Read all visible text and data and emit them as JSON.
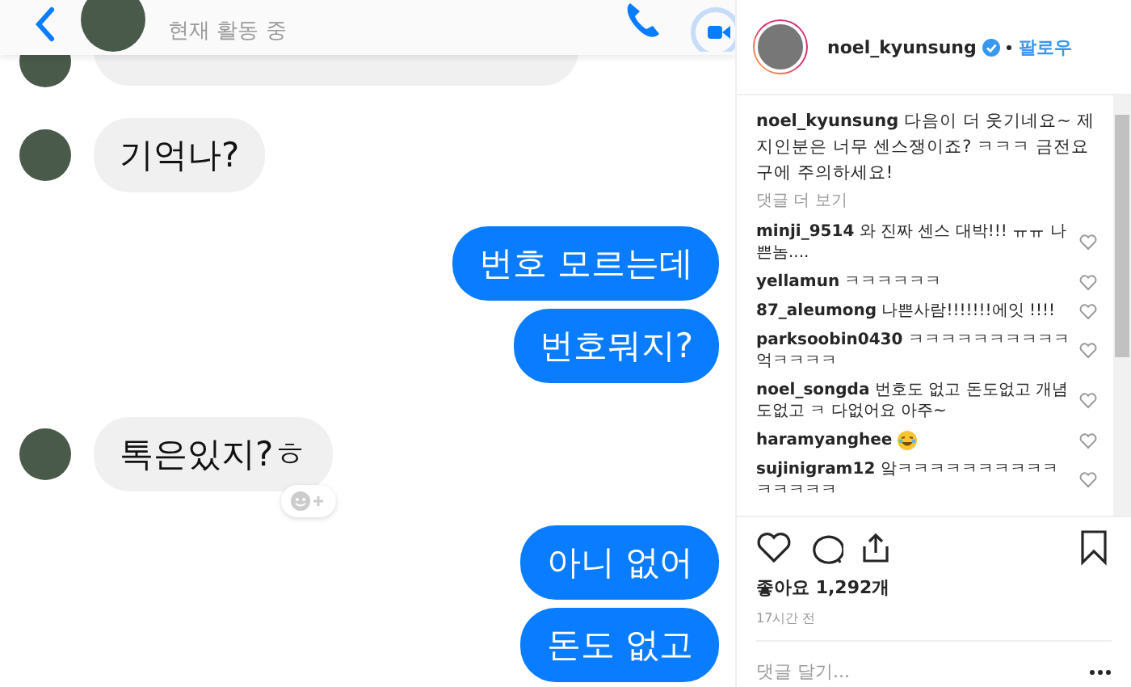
{
  "chat": {
    "status": "현재 활동 중",
    "messages": [
      {
        "kind": "partial",
        "avatar": true,
        "reaction_button": false
      },
      {
        "kind": "incoming",
        "text": "기억나?",
        "avatar": true,
        "reaction_button": false
      },
      {
        "kind": "outgoing",
        "text": "번호 모르는데",
        "avatar": false,
        "reaction_button": false
      },
      {
        "kind": "outgoing",
        "text": "번호뭐지?",
        "avatar": false,
        "reaction_button": false
      },
      {
        "kind": "incoming",
        "text": "톡은있지?ㅎ",
        "avatar": true,
        "reaction_button": true
      },
      {
        "kind": "outgoing",
        "text": "아니 없어",
        "avatar": false,
        "reaction_button": false
      },
      {
        "kind": "outgoing",
        "text": "돈도 없고",
        "avatar": false,
        "reaction_button": false
      }
    ]
  },
  "post": {
    "author": "noel_kyunsung",
    "verified": true,
    "follow": "팔로우",
    "caption": {
      "user": "noel_kyunsung",
      "text": "다음이 더 웃기네요~ 제 지인분은 너무 센스쟁이죠? ㅋㅋㅋ 금전요구에 주의하세요!"
    },
    "more_comments": "댓글 더 보기",
    "comments": [
      {
        "user": "minji_9514",
        "text": "와 진짜 센스 대박!!! ㅠㅠ 나쁜놈....",
        "emoji": false
      },
      {
        "user": "yellamun",
        "text": "ㅋㅋㅋㅋㅋㅋ",
        "emoji": false
      },
      {
        "user": "87_aleumong",
        "text": "나쁜사람!!!!!!!에잇 !!!!",
        "emoji": false
      },
      {
        "user": "parksoobin0430",
        "text": "ㅋㅋㅋㅋㅋㅋㅋㅋㅋㅋ억ㅋㅋㅋㅋ",
        "emoji": false
      },
      {
        "user": "noel_songda",
        "text": "번호도 없고 돈도없고 개념도없고 ㅋ 다없어요 아주~",
        "emoji": false
      },
      {
        "user": "haramyanghee",
        "emoji": true
      },
      {
        "user": "sujinigram12",
        "text": "앜ㅋㅋㅋㅋㅋㅋㅋㅋㅋㅋㅋㅋㅋㅋㅋ",
        "emoji": false
      }
    ],
    "likes": "좋아요 1,292개",
    "time": "17시간 전",
    "comment_field": {
      "placeholder": "댓글 달기..."
    }
  }
}
